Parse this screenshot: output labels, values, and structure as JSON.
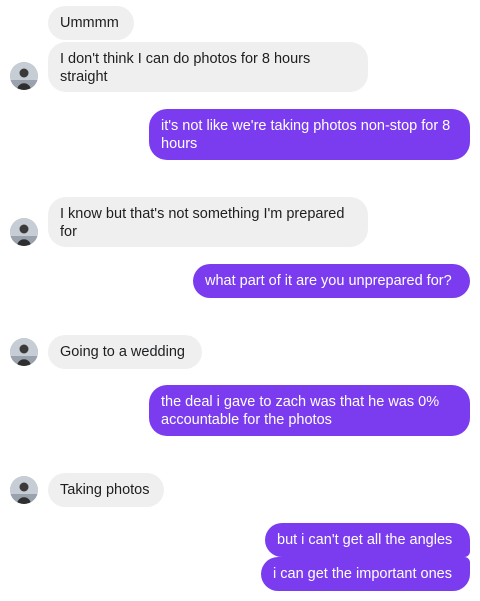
{
  "messages": [
    {
      "text": "Ummmm"
    },
    {
      "text": "I don't think I can do photos for 8 hours straight"
    },
    {
      "text": "it's not like we're taking photos non-stop for 8 hours"
    },
    {
      "text": "I know but that's not something I'm prepared for"
    },
    {
      "text": "what part of it are you unprepared for?"
    },
    {
      "text": "Going to a wedding"
    },
    {
      "text": "the deal i gave to zach was that he was 0% accountable for the photos"
    },
    {
      "text": "Taking photos"
    },
    {
      "text": "but i can't get all the angles"
    },
    {
      "text": "i can get the important ones"
    }
  ],
  "colors": {
    "incoming_bubble": "#efefef",
    "outgoing_bubble": "#7b3cf0"
  },
  "icons": {
    "avatar": "contact-avatar-icon"
  }
}
